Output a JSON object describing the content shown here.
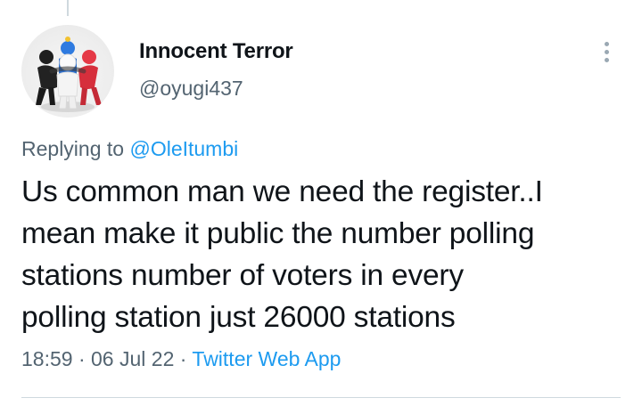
{
  "author": {
    "display_name": "Innocent Terror",
    "handle": "@oyugi437",
    "avatar_icon": "3d-figures-huddle-avatar"
  },
  "more_menu": {
    "icon": "more-vertical-icon"
  },
  "reply_context": {
    "prefix": "Replying to",
    "mention": "@OleItumbi"
  },
  "tweet": {
    "lines": [
      "Us common man we need the register..I",
      "mean make it public the number polling",
      "stations number of voters in every",
      "polling station just 26000 stations"
    ]
  },
  "meta": {
    "time": "18:59",
    "separator": "·",
    "date": "06 Jul 22",
    "source": "Twitter Web App"
  },
  "colors": {
    "accent": "#1d9bf0",
    "secondary_text": "#536471",
    "primary_text": "#0f1419",
    "divider": "#cfd9de"
  }
}
